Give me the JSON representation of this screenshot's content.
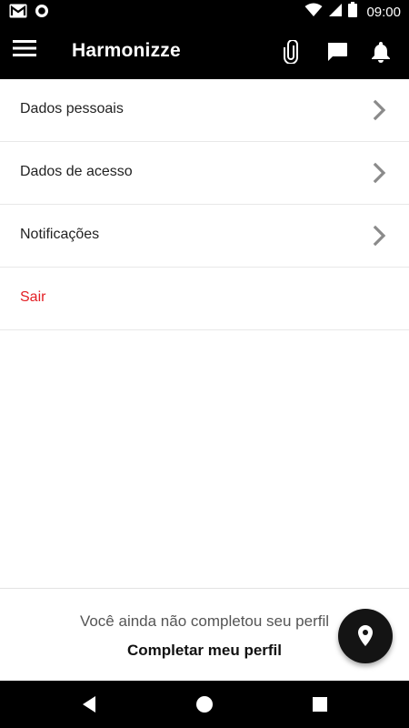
{
  "status_bar": {
    "time": "09:00",
    "icons": [
      "gmail-icon",
      "record-icon",
      "wifi-icon",
      "signal-icon",
      "battery-icon"
    ]
  },
  "app_bar": {
    "title": "Harmonizze",
    "icons": [
      "menu-icon",
      "paperclip-icon",
      "chat-icon",
      "bell-icon"
    ]
  },
  "menu": {
    "items": [
      {
        "label": "Dados pessoais"
      },
      {
        "label": "Dados de acesso"
      },
      {
        "label": "Notificações"
      }
    ],
    "logout_label": "Sair"
  },
  "footer": {
    "message": "Você ainda não completou seu perfil",
    "link": "Completar meu perfil"
  },
  "colors": {
    "bar": "#000000",
    "logout": "#e31e24",
    "fab": "#141414"
  }
}
